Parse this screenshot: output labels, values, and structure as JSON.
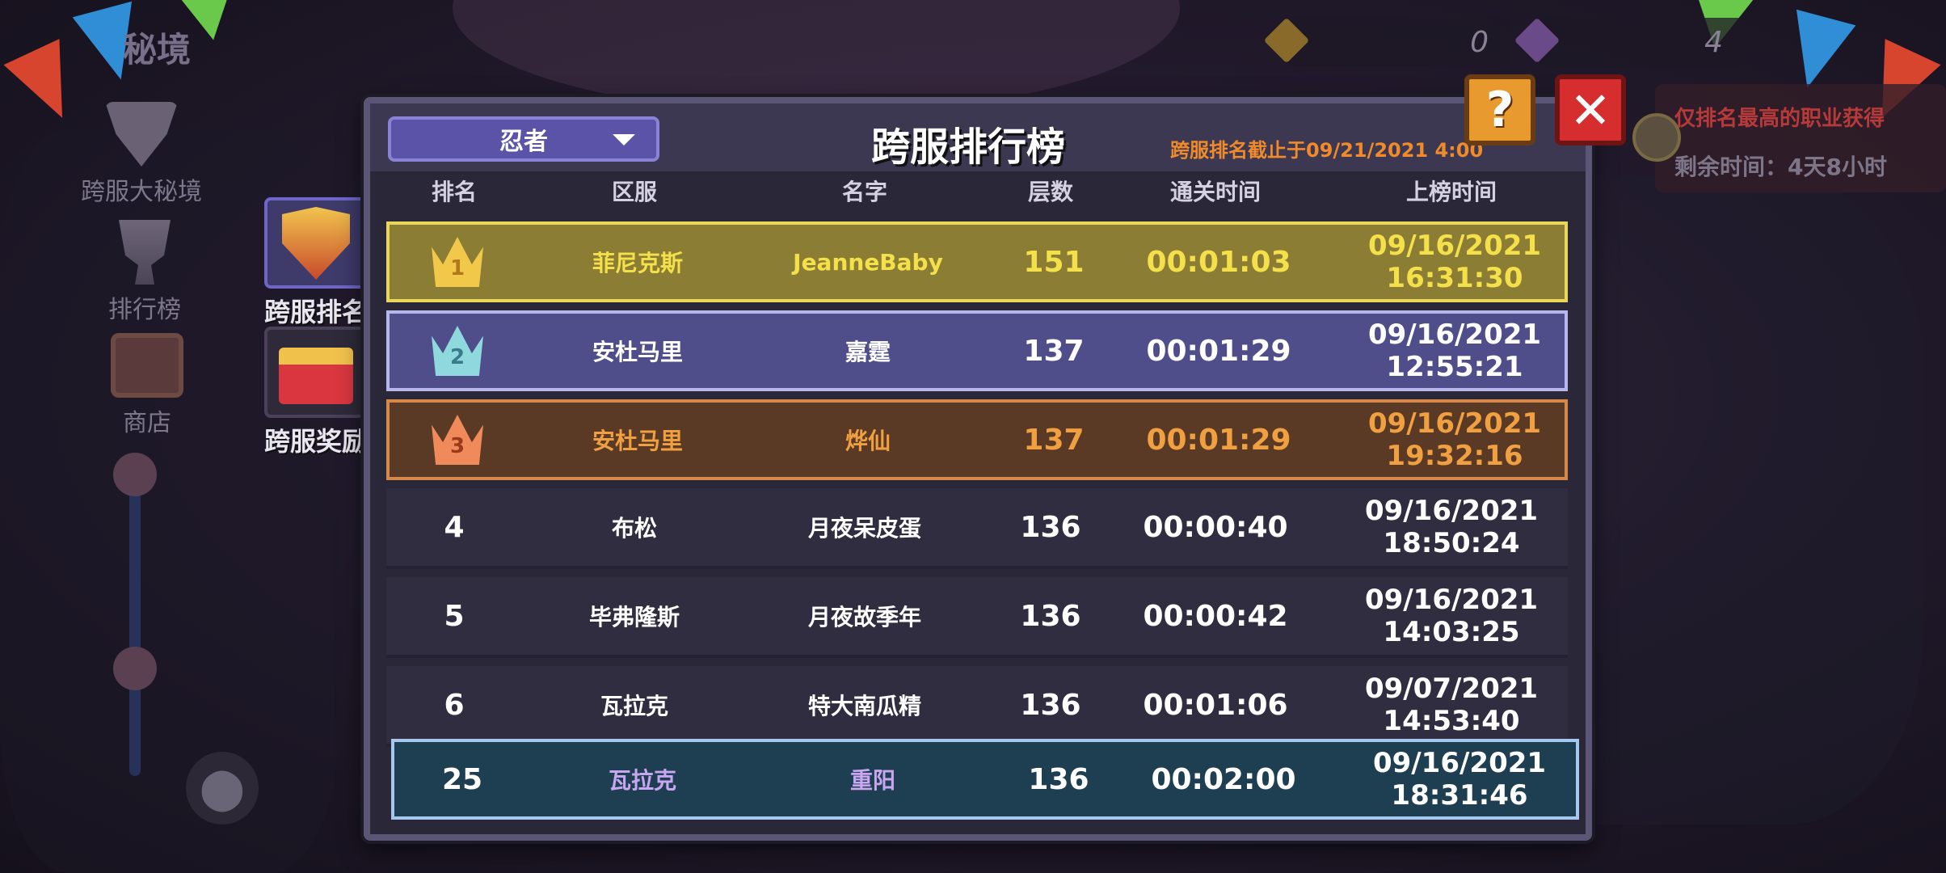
{
  "corner_title": "秘境",
  "currency": [
    {
      "icon": "amber-gem-icon",
      "value": "0",
      "color": "#8a6a2a"
    },
    {
      "icon": "purple-gem-icon",
      "value": "4",
      "color": "#6a4a88"
    }
  ],
  "sidebar": {
    "items": [
      {
        "label": "跨服大秘境",
        "icon": "medal-icon"
      },
      {
        "label": "排行榜",
        "icon": "trophy-icon"
      },
      {
        "label": "商店",
        "icon": "shop-icon"
      }
    ]
  },
  "tabs": [
    {
      "label": "跨服排名",
      "icon": "shield-emblem-icon",
      "active": true
    },
    {
      "label": "跨服奖励",
      "icon": "treasure-chest-icon",
      "active": false
    }
  ],
  "hint": {
    "top_text": "仅排名最高的职业获得",
    "remaining": "剩余时间：4天8小时"
  },
  "panel": {
    "class_select": "忍者",
    "title": "跨服排行榜",
    "cutoff": "跨服排名截止于09/21/2021 4:00",
    "columns": [
      "排名",
      "区服",
      "名字",
      "层数",
      "通关时间",
      "上榜时间"
    ],
    "rows": [
      {
        "rank": "1",
        "server": "菲尼克斯",
        "name": "JeanneBaby",
        "floor": "151",
        "clear": "00:01:03",
        "date": "09/16/2021",
        "time": "16:31:30"
      },
      {
        "rank": "2",
        "server": "安杜马里",
        "name": "嘉霆",
        "floor": "137",
        "clear": "00:01:29",
        "date": "09/16/2021",
        "time": "12:55:21"
      },
      {
        "rank": "3",
        "server": "安杜马里",
        "name": "烨仙",
        "floor": "137",
        "clear": "00:01:29",
        "date": "09/16/2021",
        "time": "19:32:16"
      },
      {
        "rank": "4",
        "server": "布松",
        "name": "月夜呆皮蛋",
        "floor": "136",
        "clear": "00:00:40",
        "date": "09/16/2021",
        "time": "18:50:24"
      },
      {
        "rank": "5",
        "server": "毕弗隆斯",
        "name": "月夜故季年",
        "floor": "136",
        "clear": "00:00:42",
        "date": "09/16/2021",
        "time": "14:03:25"
      },
      {
        "rank": "6",
        "server": "瓦拉克",
        "name": "特大南瓜精",
        "floor": "136",
        "clear": "00:01:06",
        "date": "09/07/2021",
        "time": "14:53:40"
      }
    ],
    "my_row": {
      "rank": "25",
      "server": "瓦拉克",
      "name": "重阳",
      "floor": "136",
      "clear": "00:02:00",
      "date": "09/16/2021",
      "time": "18:31:46"
    }
  },
  "buttons": {
    "help": "?",
    "close": "✕"
  },
  "colors": {
    "gold_text": "#f4e04a",
    "silver_text": "#ffffff",
    "bronze_text": "#f0a040",
    "self_text": "#c8a6f0",
    "gold_crown": "#f2c84a",
    "silver_crown": "#8fd8de",
    "bronze_crown": "#f08a5a"
  }
}
